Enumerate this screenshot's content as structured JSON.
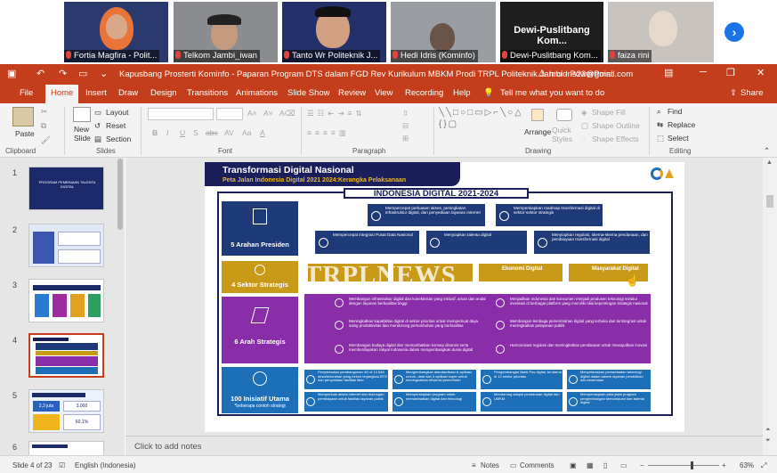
{
  "meeting": {
    "participants": [
      {
        "name": "Fortia Magfira - Polit...",
        "muted": true
      },
      {
        "name": "Telkom Jambi_iwan",
        "muted": true
      },
      {
        "name": "Tanto Wr Politeknik J...",
        "muted": true
      },
      {
        "name": "Hedi Idris (Kominfo)",
        "muted": true
      },
      {
        "name": "Dewi-Puslitbang Kom...",
        "muted": true,
        "center_label": "Dewi-Puslitbang Kom..."
      },
      {
        "name": "faiza rini",
        "muted": true
      }
    ],
    "next_icon": "chevron-right-icon"
  },
  "window": {
    "title": "Kapusbang Prosterti Kominfo - Paparan Program DTS dalam FGD Rev Kurikulum MBKM Prodi TRPL Politeknik Jambi - PowerPoint",
    "user": "hmidris22@gmail.com",
    "controls": [
      "─",
      "❐",
      "✕"
    ]
  },
  "tabs": [
    "File",
    "Home",
    "Insert",
    "Draw",
    "Design",
    "Transitions",
    "Animations",
    "Slide Show",
    "Review",
    "View",
    "Recording",
    "Help"
  ],
  "active_tab": "Home",
  "tell_me": "Tell me what you want to do",
  "share": "Share",
  "ribbon": {
    "clipboard": {
      "paste": "Paste",
      "group": "Clipboard"
    },
    "slides": {
      "new_slide": "New Slide",
      "layout": "Layout",
      "reset": "Reset",
      "section": "Section",
      "group": "Slides"
    },
    "font": {
      "group": "Font",
      "buttons": [
        "B",
        "I",
        "U",
        "S",
        "abc",
        "AV",
        "Aa",
        "A"
      ]
    },
    "paragraph": {
      "group": "Paragraph"
    },
    "drawing": {
      "arrange": "Arrange",
      "quick_styles": "Quick Styles",
      "shape_fill": "Shape Fill",
      "shape_outline": "Shape Outline",
      "shape_effects": "Shape Effects",
      "group": "Drawing"
    },
    "editing": {
      "find": "Find",
      "replace": "Replace",
      "select": "Select",
      "group": "Editing"
    }
  },
  "thumbnails": {
    "numbers": [
      "1",
      "2",
      "3",
      "4",
      "5",
      "6"
    ],
    "selected": "4",
    "t1_title": "PROGRAM PEMBINAAN TALENTA DIGITAL",
    "t5_stats": [
      "2,3 juta",
      "3.000",
      "60,1%"
    ]
  },
  "slide": {
    "title": "Transformasi Digital Nasional",
    "subtitle": "Peta Jalan Indonesia Digital 2021  2024:Kerangka Pelaksanaan",
    "badge": "INDONESIA DIGITAL 2021-2024",
    "left_blocks": [
      "5 Arahan Presiden",
      "4 Sektor Strategis",
      "6 Arah Strategis",
      "100 Inisiatif Utama"
    ],
    "left_block_note": "*beberapa contoh strategi",
    "arahan_top": [
      "Mempercepat perluasan akses, peningkatan infrastruktur digital, dan  penyediaan layanan internet",
      "Mempersiapkan roadmap transformasi digital di sektor-sektor strategis"
    ],
    "arahan_bottom": [
      "Mempercepat integrasi Pusat Data Nasional",
      "Menyiapkan talenta digital",
      "Menyiapkan regulasi, skema-skema pendanaan, dan pembiayaan  transformasi digital"
    ],
    "sektor": [
      "",
      "",
      "Ekonomi Digital",
      "Masyarakat Digital"
    ],
    "arah_left": [
      "Membangun infrastruktur digital dan konektivitas yang inklusif, aman dan andal dengan layanan berkualitas tinggi",
      "Meningkatkan kapabilitas digital di sektor prioritas untuk memperkuat daya saing produktivitas dan mendorong pertumbuhan yang berkualitas",
      "Membangun budaya digital dan memanfaatkan konsep dinamis serta memberdayakan rakyat Indonesia dalam mengembangkan dunia digital"
    ],
    "arah_right": [
      "Menjadikan Indonesia dari konsumen menjadi produsen teknologi melalui investasi di berbagai platform yang memiliki nilai kepentingan strategis nasional",
      "Membangun lembaga pemerintahan digital yang terbuka dan terintegrasi untuk meningkatkan pelayanan publik",
      "Harmonisasi regulasi dan meningkatkan pendanaan untuk mewujudkan inovasi"
    ],
    "inisiatif": [
      "Penyelesaian pembangunan 4G di 12.548 desa/kelurahan yang belum terjangkau BTS dan penyediaan fasilitas fiber",
      "Mengembangkan standardisasi & aplikasi umum, data dan 3 aplikasi super untuk meningkatkan efisiensi pemerintah",
      "Pengembangan Bakti Pos digital, terutama di 12 sektor prioritas",
      "Menyelaraskan pemanfaatan teknologi digital dalam sistem layanan pendidikan dan kesehatan",
      "Memperluas akses internet dan dukungan pembiayaan untuk fasilitas layanan publik",
      "Mempersiapkan program untuk memanfaatkan digital dan teknologi",
      "Mendorong adopsi pendanaan digital dan UMKM",
      "Mempersiapkan peta jalan program pengembangan kemampuan dan talenta digital"
    ],
    "watermark": "TRPLNEWS"
  },
  "notes_placeholder": "Click to add notes",
  "status": {
    "slide": "Slide 4 of 23",
    "language": "English (Indonesia)",
    "notes": "Notes",
    "comments": "Comments",
    "zoom": "63%"
  },
  "colors": {
    "accent": "#c43e1c",
    "navy": "#1a1f5a",
    "purple": "#8a2da8",
    "gold": "#c99a18",
    "blue": "#1d6fb8"
  }
}
